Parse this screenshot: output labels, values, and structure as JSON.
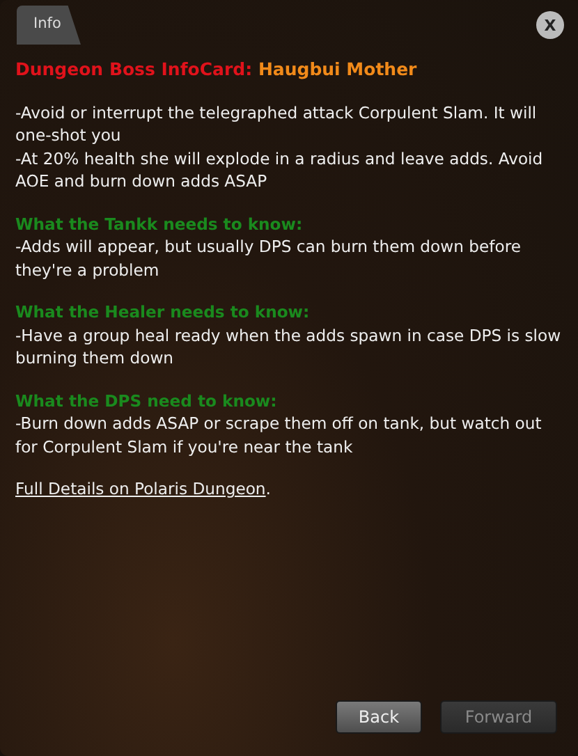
{
  "tab": {
    "label": "Info",
    "selected": true
  },
  "close": {
    "label": "X"
  },
  "title": {
    "prefix": "Dungeon Boss InfoCard:",
    "name": "Haugbui Mother"
  },
  "intro": [
    "-Avoid or interrupt the telegraphed attack Corpulent Slam. It will one-shot you",
    "-At 20% health she will explode in a radius and leave adds. Avoid AOE and burn down adds ASAP"
  ],
  "sections": [
    {
      "heading": "What the Tankk needs to know:",
      "body": "-Adds will appear, but usually DPS can burn them down before they're a problem"
    },
    {
      "heading": "What the Healer needs to know:",
      "body": "-Have a group heal ready when the adds spawn in case DPS is slow burning them down"
    },
    {
      "heading": "What the DPS need to know:",
      "body": "-Burn down adds ASAP or scrape them off on tank, but watch out for Corpulent Slam if you're near the tank"
    }
  ],
  "link": {
    "text": "Full Details on Polaris Dungeon",
    "after": "."
  },
  "buttons": [
    {
      "label": "Back",
      "disabled": false
    },
    {
      "label": "Forward",
      "disabled": true
    }
  ]
}
